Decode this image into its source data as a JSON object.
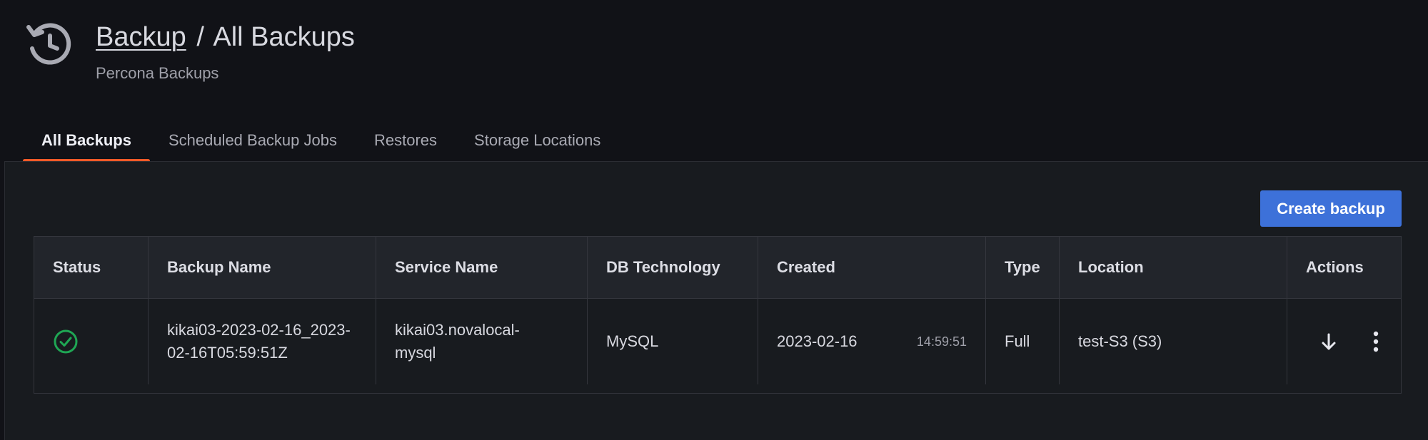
{
  "header": {
    "breadcrumb_parent": "Backup",
    "separator": "/",
    "title": "All Backups",
    "subtitle": "Percona Backups",
    "icon": "history-icon"
  },
  "tabs": [
    {
      "label": "All Backups",
      "active": true
    },
    {
      "label": "Scheduled Backup Jobs",
      "active": false
    },
    {
      "label": "Restores",
      "active": false
    },
    {
      "label": "Storage Locations",
      "active": false
    }
  ],
  "toolbar": {
    "create_label": "Create backup",
    "create_color": "#3d71d9"
  },
  "table": {
    "columns": [
      "Status",
      "Backup Name",
      "Service Name",
      "DB Technology",
      "Created",
      "Type",
      "Location",
      "Actions"
    ],
    "rows": [
      {
        "status": "success",
        "status_icon": "check-circle-icon",
        "status_color": "#1fa654",
        "backup_name": "kikai03-2023-02-16_2023-02-16T05:59:51Z",
        "backup_name_line1": "kikai03-2023-02-16_2023-",
        "backup_name_line2": "02-16T05:59:51Z",
        "service_name_line1": "kikai03.novalocal-",
        "service_name_line2": "mysql",
        "db_technology": "MySQL",
        "created_date": "2023-02-16",
        "created_time": "14:59:51",
        "type": "Full",
        "location": "test-S3 (S3)",
        "actions": [
          "arrow-down-icon",
          "more-vertical-icon"
        ]
      }
    ]
  },
  "colors": {
    "background": "#111217",
    "panel": "#181b1f",
    "accent_tab": "#f05a28"
  }
}
